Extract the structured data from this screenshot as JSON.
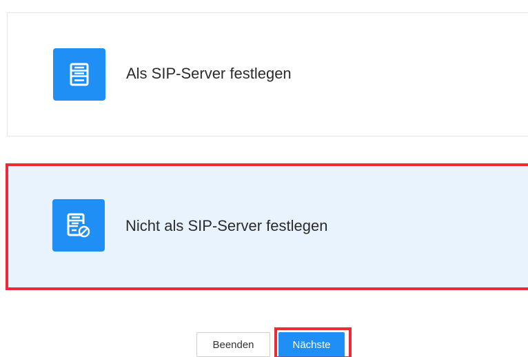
{
  "options": [
    {
      "label": "Als SIP-Server festlegen",
      "icon": "server-icon",
      "selected": false
    },
    {
      "label": "Nicht als SIP-Server festlegen",
      "icon": "server-blocked-icon",
      "selected": true
    }
  ],
  "footer": {
    "quit_label": "Beenden",
    "next_label": "Nächste"
  },
  "colors": {
    "accent": "#1f8ff5",
    "selected_background": "#e8f3fd",
    "highlight_border": "#ee2a36"
  }
}
